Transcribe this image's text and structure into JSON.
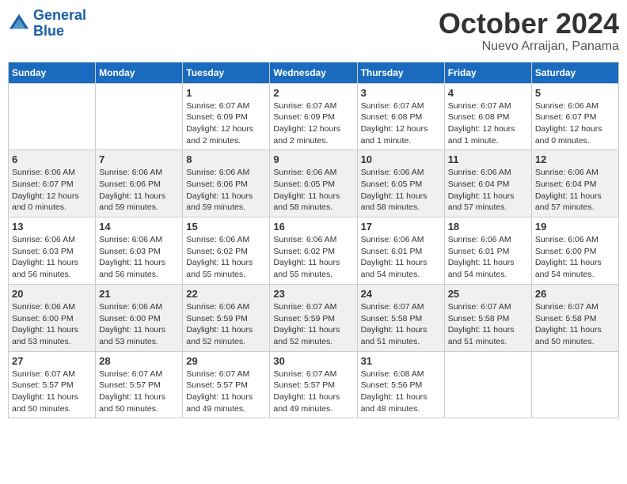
{
  "header": {
    "logo": {
      "line1": "General",
      "line2": "Blue"
    },
    "title": "October 2024",
    "subtitle": "Nuevo Arraijan, Panama"
  },
  "days_of_week": [
    "Sunday",
    "Monday",
    "Tuesday",
    "Wednesday",
    "Thursday",
    "Friday",
    "Saturday"
  ],
  "weeks": [
    [
      {
        "day": "",
        "info": ""
      },
      {
        "day": "",
        "info": ""
      },
      {
        "day": "1",
        "info": "Sunrise: 6:07 AM\nSunset: 6:09 PM\nDaylight: 12 hours\nand 2 minutes."
      },
      {
        "day": "2",
        "info": "Sunrise: 6:07 AM\nSunset: 6:09 PM\nDaylight: 12 hours\nand 2 minutes."
      },
      {
        "day": "3",
        "info": "Sunrise: 6:07 AM\nSunset: 6:08 PM\nDaylight: 12 hours\nand 1 minute."
      },
      {
        "day": "4",
        "info": "Sunrise: 6:07 AM\nSunset: 6:08 PM\nDaylight: 12 hours\nand 1 minute."
      },
      {
        "day": "5",
        "info": "Sunrise: 6:06 AM\nSunset: 6:07 PM\nDaylight: 12 hours\nand 0 minutes."
      }
    ],
    [
      {
        "day": "6",
        "info": "Sunrise: 6:06 AM\nSunset: 6:07 PM\nDaylight: 12 hours\nand 0 minutes."
      },
      {
        "day": "7",
        "info": "Sunrise: 6:06 AM\nSunset: 6:06 PM\nDaylight: 11 hours\nand 59 minutes."
      },
      {
        "day": "8",
        "info": "Sunrise: 6:06 AM\nSunset: 6:06 PM\nDaylight: 11 hours\nand 59 minutes."
      },
      {
        "day": "9",
        "info": "Sunrise: 6:06 AM\nSunset: 6:05 PM\nDaylight: 11 hours\nand 58 minutes."
      },
      {
        "day": "10",
        "info": "Sunrise: 6:06 AM\nSunset: 6:05 PM\nDaylight: 11 hours\nand 58 minutes."
      },
      {
        "day": "11",
        "info": "Sunrise: 6:06 AM\nSunset: 6:04 PM\nDaylight: 11 hours\nand 57 minutes."
      },
      {
        "day": "12",
        "info": "Sunrise: 6:06 AM\nSunset: 6:04 PM\nDaylight: 11 hours\nand 57 minutes."
      }
    ],
    [
      {
        "day": "13",
        "info": "Sunrise: 6:06 AM\nSunset: 6:03 PM\nDaylight: 11 hours\nand 56 minutes."
      },
      {
        "day": "14",
        "info": "Sunrise: 6:06 AM\nSunset: 6:03 PM\nDaylight: 11 hours\nand 56 minutes."
      },
      {
        "day": "15",
        "info": "Sunrise: 6:06 AM\nSunset: 6:02 PM\nDaylight: 11 hours\nand 55 minutes."
      },
      {
        "day": "16",
        "info": "Sunrise: 6:06 AM\nSunset: 6:02 PM\nDaylight: 11 hours\nand 55 minutes."
      },
      {
        "day": "17",
        "info": "Sunrise: 6:06 AM\nSunset: 6:01 PM\nDaylight: 11 hours\nand 54 minutes."
      },
      {
        "day": "18",
        "info": "Sunrise: 6:06 AM\nSunset: 6:01 PM\nDaylight: 11 hours\nand 54 minutes."
      },
      {
        "day": "19",
        "info": "Sunrise: 6:06 AM\nSunset: 6:00 PM\nDaylight: 11 hours\nand 54 minutes."
      }
    ],
    [
      {
        "day": "20",
        "info": "Sunrise: 6:06 AM\nSunset: 6:00 PM\nDaylight: 11 hours\nand 53 minutes."
      },
      {
        "day": "21",
        "info": "Sunrise: 6:06 AM\nSunset: 6:00 PM\nDaylight: 11 hours\nand 53 minutes."
      },
      {
        "day": "22",
        "info": "Sunrise: 6:06 AM\nSunset: 5:59 PM\nDaylight: 11 hours\nand 52 minutes."
      },
      {
        "day": "23",
        "info": "Sunrise: 6:07 AM\nSunset: 5:59 PM\nDaylight: 11 hours\nand 52 minutes."
      },
      {
        "day": "24",
        "info": "Sunrise: 6:07 AM\nSunset: 5:58 PM\nDaylight: 11 hours\nand 51 minutes."
      },
      {
        "day": "25",
        "info": "Sunrise: 6:07 AM\nSunset: 5:58 PM\nDaylight: 11 hours\nand 51 minutes."
      },
      {
        "day": "26",
        "info": "Sunrise: 6:07 AM\nSunset: 5:58 PM\nDaylight: 11 hours\nand 50 minutes."
      }
    ],
    [
      {
        "day": "27",
        "info": "Sunrise: 6:07 AM\nSunset: 5:57 PM\nDaylight: 11 hours\nand 50 minutes."
      },
      {
        "day": "28",
        "info": "Sunrise: 6:07 AM\nSunset: 5:57 PM\nDaylight: 11 hours\nand 50 minutes."
      },
      {
        "day": "29",
        "info": "Sunrise: 6:07 AM\nSunset: 5:57 PM\nDaylight: 11 hours\nand 49 minutes."
      },
      {
        "day": "30",
        "info": "Sunrise: 6:07 AM\nSunset: 5:57 PM\nDaylight: 11 hours\nand 49 minutes."
      },
      {
        "day": "31",
        "info": "Sunrise: 6:08 AM\nSunset: 5:56 PM\nDaylight: 11 hours\nand 48 minutes."
      },
      {
        "day": "",
        "info": ""
      },
      {
        "day": "",
        "info": ""
      }
    ]
  ]
}
